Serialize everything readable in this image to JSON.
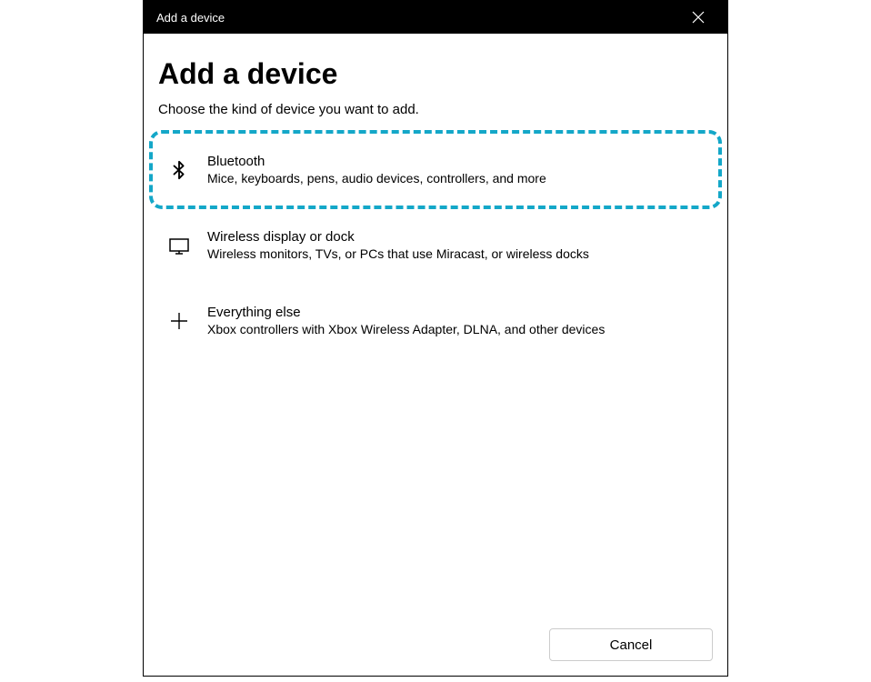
{
  "titleBar": {
    "title": "Add a device"
  },
  "heading": "Add a device",
  "subheading": "Choose the kind of device you want to add.",
  "options": [
    {
      "title": "Bluetooth",
      "description": "Mice, keyboards, pens, audio devices, controllers, and more",
      "highlighted": true
    },
    {
      "title": "Wireless display or dock",
      "description": "Wireless monitors, TVs, or PCs that use Miracast, or wireless docks",
      "highlighted": false
    },
    {
      "title": "Everything else",
      "description": "Xbox controllers with Xbox Wireless Adapter, DLNA, and other devices",
      "highlighted": false
    }
  ],
  "footer": {
    "cancelLabel": "Cancel"
  }
}
